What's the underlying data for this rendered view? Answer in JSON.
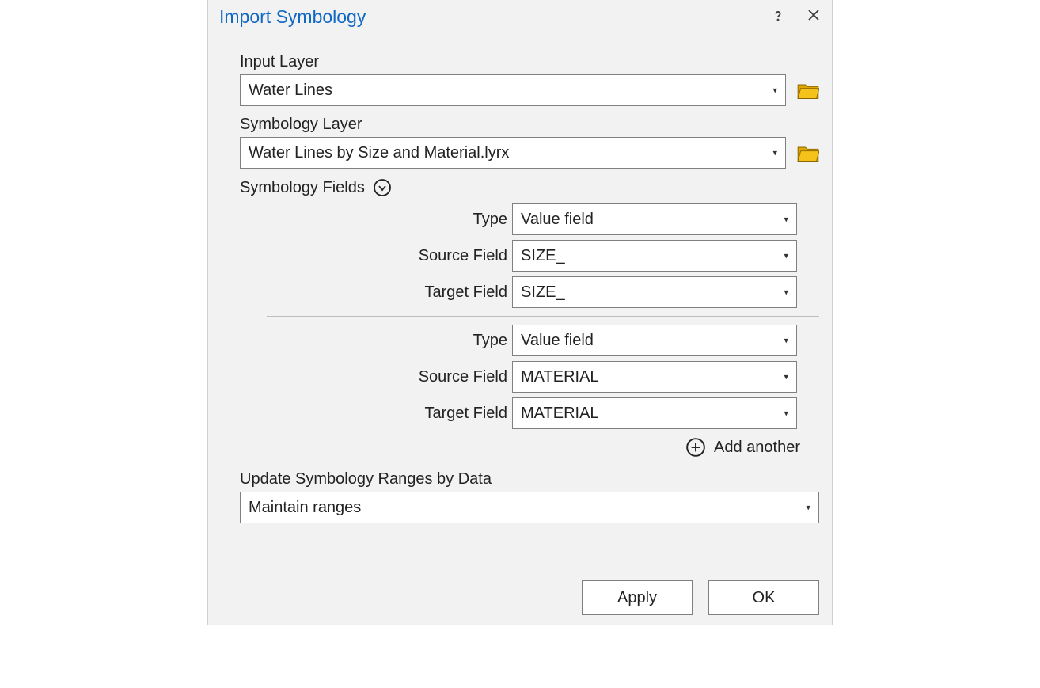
{
  "dialog": {
    "title": "Import Symbology"
  },
  "inputs": {
    "input_layer_label": "Input Layer",
    "input_layer_value": "Water Lines",
    "symbology_layer_label": "Symbology Layer",
    "symbology_layer_value": "Water Lines by Size and Material.lyrx"
  },
  "symbology_fields": {
    "header": "Symbology Fields",
    "groups": [
      {
        "type_label": "Type",
        "type_value": "Value field",
        "source_label": "Source Field",
        "source_value": "SIZE_",
        "target_label": "Target Field",
        "target_value": "SIZE_"
      },
      {
        "type_label": "Type",
        "type_value": "Value field",
        "source_label": "Source Field",
        "source_value": "MATERIAL",
        "target_label": "Target Field",
        "target_value": "MATERIAL"
      }
    ],
    "add_another": "Add another"
  },
  "update": {
    "label": "Update Symbology Ranges by Data",
    "value": "Maintain ranges"
  },
  "footer": {
    "apply": "Apply",
    "ok": "OK"
  }
}
